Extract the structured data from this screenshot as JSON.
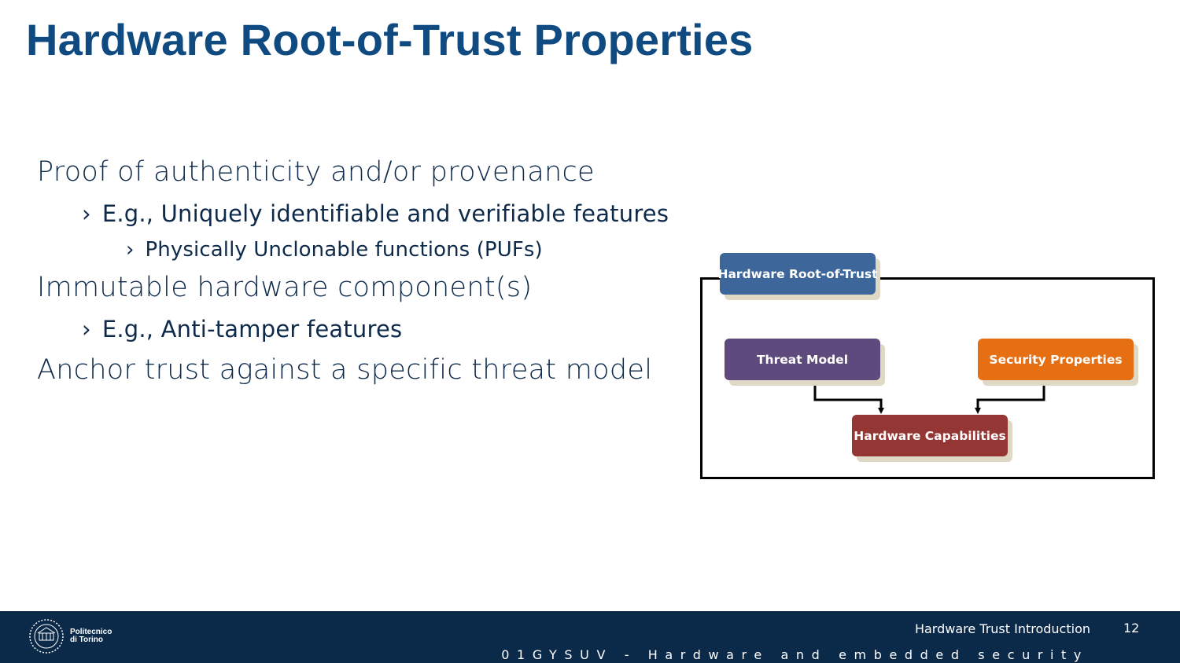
{
  "slide": {
    "title": "Hardware Root-of-Trust Properties"
  },
  "bullets": {
    "chevron": "›",
    "l1_a": "Proof of authenticity and/or provenance",
    "l2_a": "E.g., Uniquely identifiable and verifiable features",
    "l3_a": "Physically Unclonable functions (PUFs)",
    "l1_b": "Immutable hardware component(s)",
    "l2_b": "E.g., Anti-tamper features",
    "l1_c": "Anchor trust against a specific threat model"
  },
  "diagram": {
    "root": {
      "label": "Hardware Root-of-Trust",
      "color": "#3d679a"
    },
    "threat_model": {
      "label": "Threat Model",
      "color": "#5e4a7d"
    },
    "security_properties": {
      "label": "Security Properties",
      "color": "#e66f14"
    },
    "hardware_capabilities": {
      "label": "Hardware Capabilities",
      "color": "#943734"
    }
  },
  "footer": {
    "institution_line1": "Politecnico",
    "institution_line2": "di Torino",
    "presentation_title": "Hardware Trust Introduction",
    "page_number": "12",
    "course": "01GYSUV - Hardware and embedded security"
  }
}
